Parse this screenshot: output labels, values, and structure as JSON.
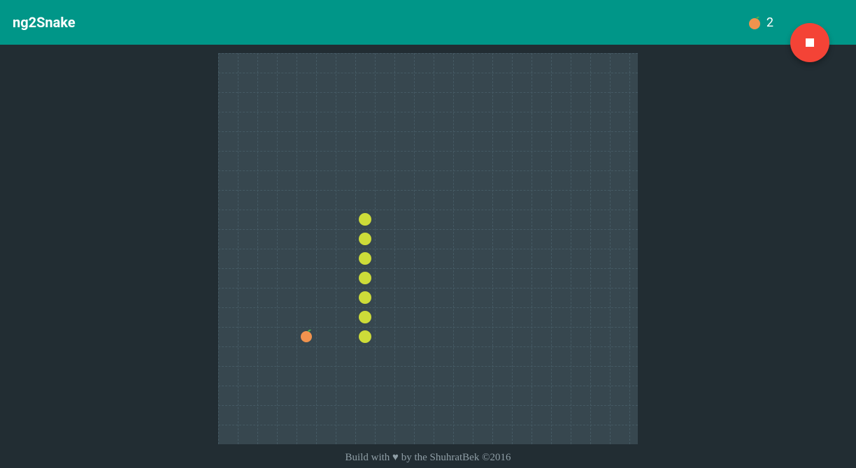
{
  "header": {
    "title": "ng2Snake",
    "score": "2"
  },
  "colors": {
    "header_bg": "#009688",
    "page_bg": "#222d33",
    "board_bg": "#37474f",
    "grid_line": "#455a64",
    "snake": "#cddc39",
    "fruit": "#f0934e",
    "leaf": "#4caf50",
    "stop_btn": "#f44336"
  },
  "board": {
    "cell_size": 28,
    "cols": 22,
    "rows": 20,
    "fruit": {
      "col": 4,
      "row": 14
    },
    "snake": [
      {
        "col": 7,
        "row": 8
      },
      {
        "col": 7,
        "row": 9
      },
      {
        "col": 7,
        "row": 10
      },
      {
        "col": 7,
        "row": 11
      },
      {
        "col": 7,
        "row": 12
      },
      {
        "col": 7,
        "row": 13
      },
      {
        "col": 7,
        "row": 14
      }
    ]
  },
  "footer": {
    "prefix": "Build with ",
    "heart": "♥",
    "suffix": " by the ShuhratBek ©2016"
  }
}
